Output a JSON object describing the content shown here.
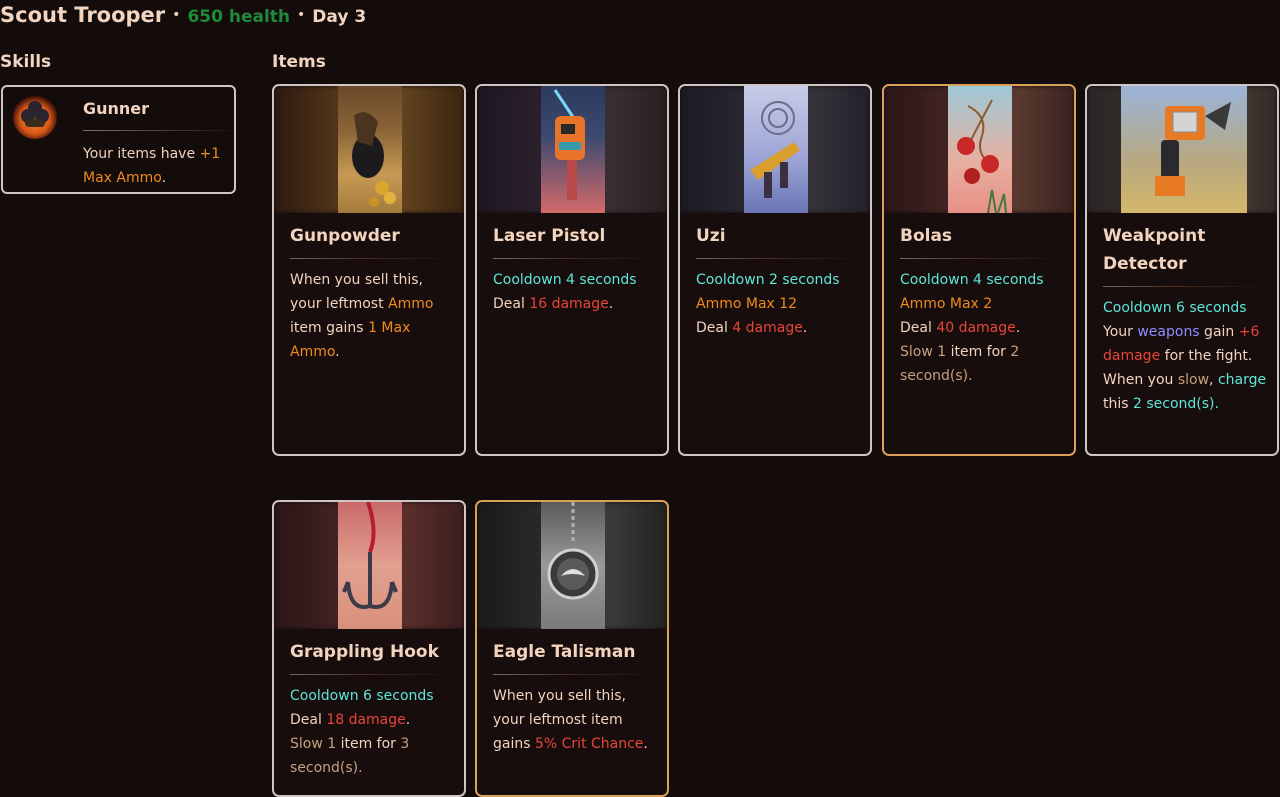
{
  "header": {
    "name": "Scout Trooper",
    "separator": "•",
    "health": "650 health",
    "day": "Day 3"
  },
  "sections": {
    "skills": "Skills",
    "items": "Items"
  },
  "skills": [
    {
      "name": "Gunner",
      "icon": "bomb-cluster-icon",
      "desc": {
        "t1": "Your items have ",
        "t2": "+1 Max Ammo",
        "t3": "."
      }
    }
  ],
  "items": [
    {
      "name": "Gunpowder",
      "icon": "gunpowder-sack-icon",
      "rarity": "silver",
      "desc": {
        "a": "When you sell this, your leftmost ",
        "b": "Ammo",
        "c": " item gains ",
        "d": "1 Max Ammo",
        "e": "."
      }
    },
    {
      "name": "Laser Pistol",
      "icon": "laser-pistol-icon",
      "rarity": "silver",
      "desc": {
        "cooldown": "Cooldown 4 seconds",
        "deal": "Deal ",
        "damage": "16 damage",
        "end": "."
      }
    },
    {
      "name": "Uzi",
      "icon": "uzi-icon",
      "rarity": "silver",
      "desc": {
        "cooldown": "Cooldown 2 seconds",
        "ammo": "Ammo Max 12",
        "deal": "Deal ",
        "damage": "4 damage",
        "end": "."
      }
    },
    {
      "name": "Bolas",
      "icon": "bolas-icon",
      "rarity": "gold",
      "desc": {
        "cooldown": "Cooldown 4 seconds",
        "ammo": "Ammo Max 2",
        "deal": "Deal ",
        "damage": "40 damage",
        "end": ".",
        "slow": "Slow",
        "slow_n": " 1",
        "slow_mid": " item for ",
        "slow_s": "2",
        "slow_end": " second(s)."
      }
    },
    {
      "name": "Weakpoint Detector",
      "icon": "weakpoint-detector-icon",
      "rarity": "silver",
      "desc": {
        "cooldown": "Cooldown 6 seconds",
        "your": "Your ",
        "weapons": "weapons",
        "gain": " gain ",
        "plus": "+6 damage",
        "fight": " for the fight. When you ",
        "slow": "slow",
        "comma": ", ",
        "charge": "charge",
        "this": " this ",
        "n": "2",
        "secs": " second(s)."
      }
    },
    {
      "name": "Grappling Hook",
      "icon": "grappling-hook-icon",
      "rarity": "silver",
      "desc": {
        "cooldown": "Cooldown 6 seconds",
        "deal": "Deal ",
        "damage": "18 damage",
        "end": ".",
        "slow": "Slow",
        "slow_n": " 1",
        "slow_mid": " item for ",
        "slow_s": "3",
        "slow_end": " second(s)."
      }
    },
    {
      "name": "Eagle Talisman",
      "icon": "eagle-talisman-icon",
      "rarity": "gold",
      "desc": {
        "a": "When you sell this, your leftmost item gains ",
        "b": "5% Crit Chance",
        "c": "."
      }
    }
  ],
  "colors": {
    "background": "#140b0b",
    "text": "#f2d4bf",
    "health": "#1f8b3a",
    "cooldown": "#5ee6d8",
    "ammo": "#ef8a1d",
    "damage": "#e8453a",
    "slow": "#c7a07e",
    "weapons": "#8f8dff",
    "border_silver": "#cfc5c5",
    "border_gold": "#d9a05a"
  }
}
